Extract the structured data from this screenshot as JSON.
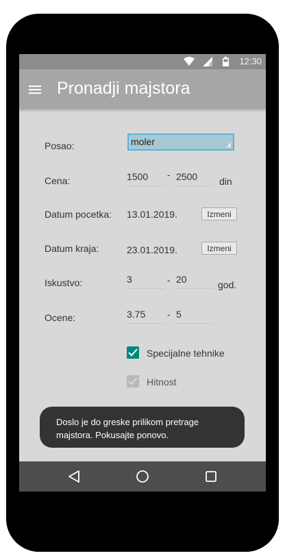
{
  "status": {
    "time": "12:30"
  },
  "appbar": {
    "title": "Pronadji majstora"
  },
  "form": {
    "posao": {
      "label": "Posao:",
      "value": "moler"
    },
    "cena": {
      "label": "Cena:",
      "from": "1500",
      "to": "2500",
      "separator": "-",
      "unit": "din"
    },
    "datum_pocetka": {
      "label": "Datum pocetka:",
      "value": "13.01.2019.",
      "button": "Izmeni"
    },
    "datum_kraja": {
      "label": "Datum kraja:",
      "value": "23.01.2019.",
      "button": "Izmeni"
    },
    "iskustvo": {
      "label": "Iskustvo:",
      "from": "3",
      "to": "20",
      "separator": "-",
      "unit": "god."
    },
    "ocene": {
      "label": "Ocene:",
      "from": "3.75",
      "to": "5",
      "separator": "-"
    },
    "checkboxes": [
      {
        "label": "Specijalne tehnike",
        "checked": true,
        "disabled": false
      },
      {
        "label": "Hitnost",
        "checked": true,
        "disabled": true
      }
    ]
  },
  "toast": {
    "message": "Doslo je do greske prilikom pretrage majstora. Pokusajte ponovo."
  },
  "navbar": {
    "icons": [
      "back-icon",
      "home-icon",
      "recents-icon"
    ]
  },
  "colors": {
    "appbar": "#a6a6a6",
    "statusbar": "#8c8c8c",
    "accent": "#00897b",
    "select": "#a7c9d6"
  }
}
